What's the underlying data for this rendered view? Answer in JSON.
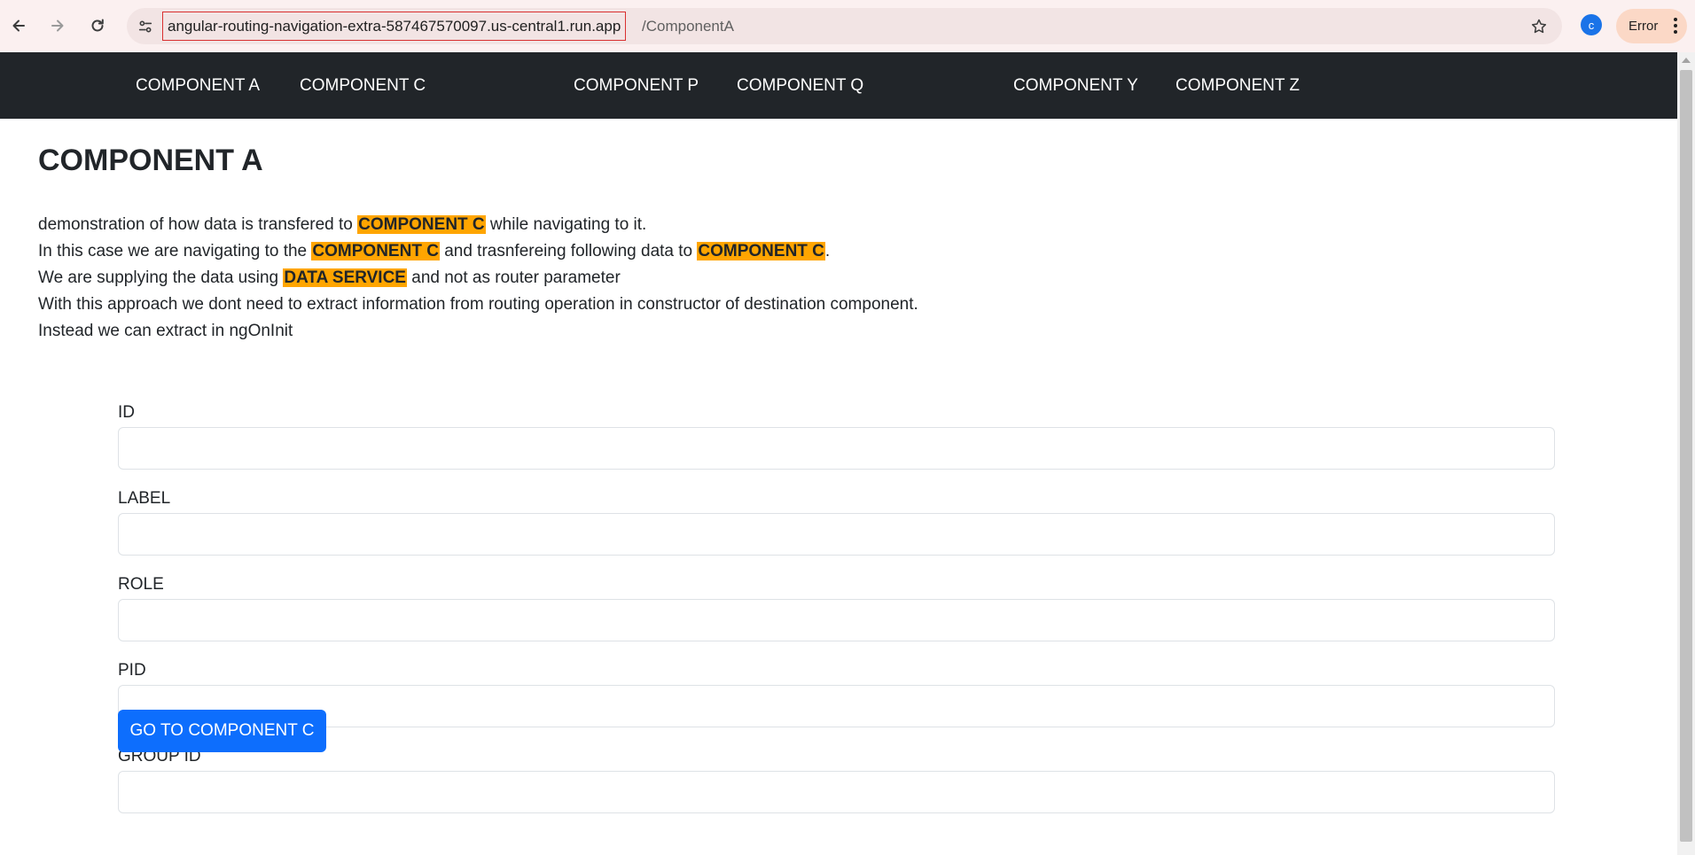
{
  "browser": {
    "url_host": "angular-routing-navigation-extra-587467570097.us-central1.run.app",
    "url_path": "/ComponentA",
    "profile_initial": "c",
    "error_label": "Error",
    "icons": {
      "back": "arrow-left-icon",
      "forward": "arrow-right-icon",
      "reload": "reload-icon",
      "site_info": "tune-icon",
      "bookmark": "star-icon",
      "menu": "kebab-menu-icon"
    }
  },
  "navbar": {
    "links": [
      {
        "label": "COMPONENT A"
      },
      {
        "label": "COMPONENT C"
      },
      {
        "label": "COMPONENT P"
      },
      {
        "label": "COMPONENT Q"
      },
      {
        "label": "COMPONENT Y"
      },
      {
        "label": "COMPONENT Z"
      }
    ]
  },
  "page": {
    "title": "COMPONENT A",
    "lines": [
      {
        "pre": "demonstration of how data is transfered to ",
        "hl1": "COMPONENT C",
        "mid": " while navigating to it.",
        "hl2": "",
        "post": ""
      },
      {
        "pre": "In this case we are navigating to the ",
        "hl1": "COMPONENT C",
        "mid": " and trasnfereing following data to ",
        "hl2": "COMPONENT C",
        "post": "."
      },
      {
        "pre": "We are supplying the data using ",
        "hl1": "DATA SERVICE",
        "mid": " and not as router parameter",
        "hl2": "",
        "post": ""
      },
      {
        "pre": "With this approach we dont need to extract information from routing operation in constructor of destination component.",
        "hl1": "",
        "mid": "",
        "hl2": "",
        "post": ""
      },
      {
        "pre": "Instead we can extract in ngOnInit",
        "hl1": "",
        "mid": "",
        "hl2": "",
        "post": ""
      }
    ],
    "highlight_color": "#ffa500"
  },
  "form": {
    "fields": [
      {
        "label": "ID",
        "value": ""
      },
      {
        "label": "LABEL",
        "value": ""
      },
      {
        "label": "ROLE",
        "value": ""
      },
      {
        "label": "PID",
        "value": ""
      },
      {
        "label": "GROUP ID",
        "value": ""
      }
    ],
    "submit_label": "GO TO COMPONENT C"
  },
  "colors": {
    "navbar_bg": "#212529",
    "button_bg": "#0d6efd"
  }
}
